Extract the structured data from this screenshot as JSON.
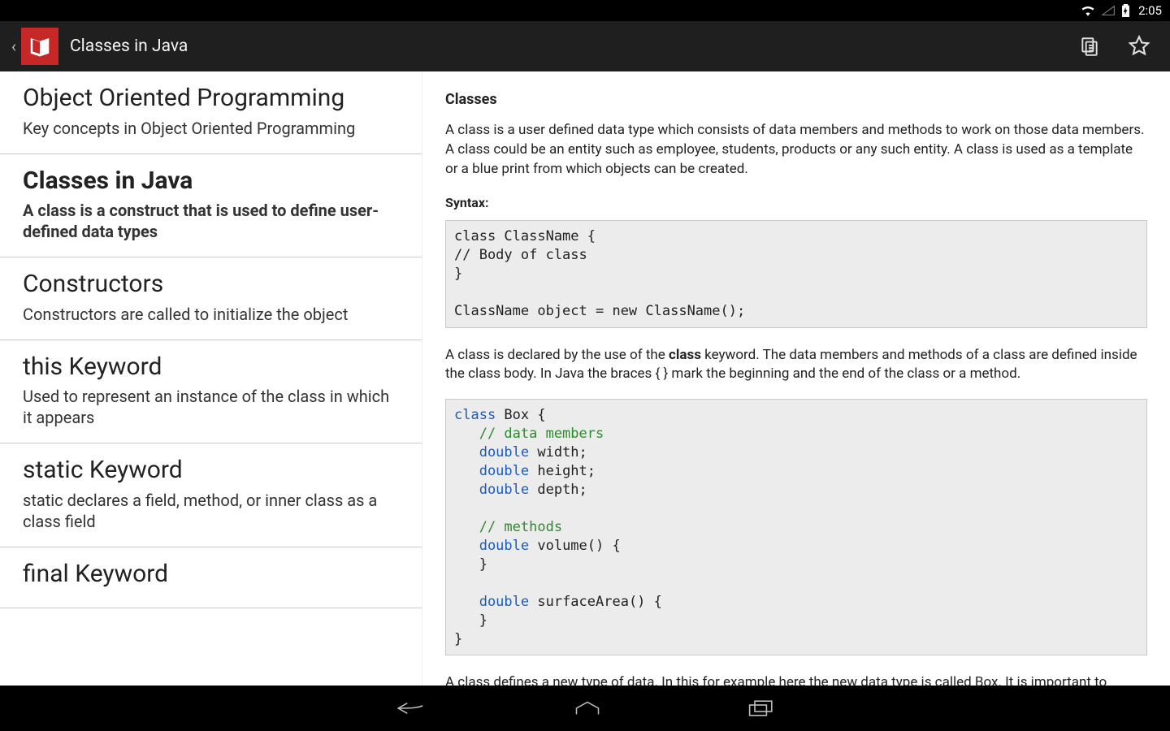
{
  "status": {
    "clock": "2:05"
  },
  "actionbar": {
    "title": "Classes in Java"
  },
  "sidebar": {
    "items": [
      {
        "title": "Object Oriented Programming",
        "subtitle": "Key concepts in Object Oriented Programming"
      },
      {
        "title": "Classes in Java",
        "subtitle": "A class is a construct that is used to define user-defined data types"
      },
      {
        "title": "Constructors",
        "subtitle": "Constructors are called to initialize the object"
      },
      {
        "title": "this Keyword",
        "subtitle": "Used to represent an instance of the class in which it appears"
      },
      {
        "title": "static Keyword",
        "subtitle": "static declares a field, method, or inner class as a class field"
      },
      {
        "title": "final Keyword",
        "subtitle": ""
      }
    ]
  },
  "content": {
    "heading": "Classes",
    "para1": "A class is a user defined data type which consists of data members and methods to work on those data members. A class could be an entity such as employee, students, products or any such entity. A class is used as a template or a blue print from which objects can be created.",
    "syntax_label": "Syntax:",
    "syntax_code": "class ClassName {\n// Body of class\n}\n\nClassName object = new ClassName();",
    "para2_a": "A class is declared by the use of the ",
    "para2_kw": "class",
    "para2_b": " keyword. The data members and methods of a class are defined inside the class body. In Java the braces { } mark the beginning and the end of the class or a method.",
    "example_code": {
      "l1a": "class",
      "l1b": " Box {",
      "l2": "   // data members",
      "l3a": "   double",
      "l3b": " width;",
      "l4a": "   double",
      "l4b": " height;",
      "l5a": "   double",
      "l5b": " depth;",
      "l6": "",
      "l7": "   // methods",
      "l8a": "   double",
      "l8b": " volume() {",
      "l9": "   }",
      "l10": "",
      "l11a": "   double",
      "l11b": " surfaceArea() {",
      "l12": "   }",
      "l13": "}"
    },
    "para3": "A class defines a new type of data. In this for example here the new data type is called Box. It is important to remember that a class declaration only creates a template; it does not create and actual object."
  }
}
